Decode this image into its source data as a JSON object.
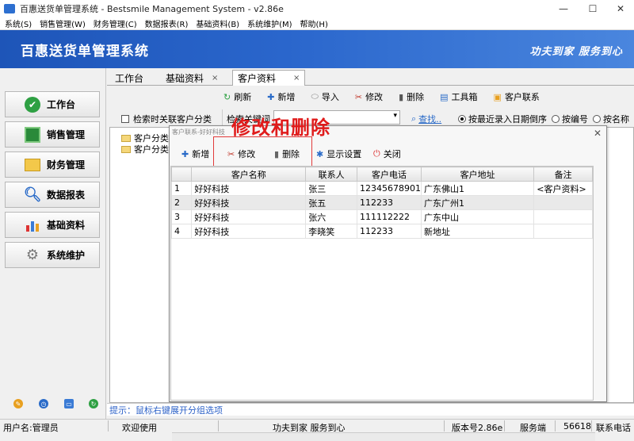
{
  "window": {
    "title": "百惠送货单管理系统 - Bestsmile Management System - v2.86e",
    "controls": {
      "minimize": "—",
      "maximize": "☐",
      "close": "✕"
    }
  },
  "menu": [
    "系统(S)",
    "销售管理(W)",
    "财务管理(C)",
    "数据报表(R)",
    "基础资料(B)",
    "系统维护(M)",
    "帮助(H)"
  ],
  "banner": {
    "title": "百惠送货单管理系统",
    "slogan": "功夫到家 服务到心"
  },
  "sidebar": {
    "items": [
      {
        "label": "工作台",
        "icon": "check-icon"
      },
      {
        "label": "销售管理",
        "icon": "sales-icon"
      },
      {
        "label": "财务管理",
        "icon": "folder-icon"
      },
      {
        "label": "数据报表",
        "icon": "magnifier-icon"
      },
      {
        "label": "基础资料",
        "icon": "chart-icon"
      },
      {
        "label": "系统维护",
        "icon": "gear-icon"
      }
    ]
  },
  "tabs": [
    {
      "label": "工作台"
    },
    {
      "label": "基础资料",
      "close": "×"
    },
    {
      "label": "客户资料",
      "close": "×"
    }
  ],
  "toolbar": {
    "refresh": "刷新",
    "add": "新增",
    "import": "导入",
    "edit": "修改",
    "delete": "删除",
    "toolbox": "工具箱",
    "contacts": "客户联系"
  },
  "search": {
    "checkbox_label": "检索时关联客户分类",
    "keyword_label": "检索关键词",
    "find_label": "查找..",
    "radios": [
      "按最近录入日期倒序",
      "按编号",
      "按名称"
    ],
    "selected_radio": 0
  },
  "tree": {
    "items": [
      "客户分类1",
      "客户分类2"
    ]
  },
  "dialog": {
    "title": "客户联系-好好科技",
    "close": "✕",
    "buttons": {
      "add": "新增",
      "edit": "修改",
      "delete": "删除",
      "display": "显示设置",
      "close": "关闭"
    },
    "overlay_annotation": "修改和删除",
    "grid": {
      "columns": [
        "",
        "客户名称",
        "联系人",
        "客户电话",
        "客户地址",
        "备注"
      ],
      "rows": [
        [
          "1",
          "好好科技",
          "张三",
          "12345678901",
          "广东佛山1",
          "<客户资料>"
        ],
        [
          "2",
          "好好科技",
          "张五",
          "112233",
          "广东广州1",
          ""
        ],
        [
          "3",
          "好好科技",
          "张六",
          "111112222",
          "广东中山",
          ""
        ],
        [
          "4",
          "好好科技",
          "李晓笑",
          "112233",
          "新地址",
          ""
        ]
      ],
      "selected_row": 1
    }
  },
  "hint": "提示：鼠标右键展开分组选项",
  "status": {
    "user": "用户名:管理员",
    "welcome": "欢迎使用",
    "slogan": "功夫到家 服务到心",
    "version": "版本号2.86e",
    "server": "服务端",
    "port": "56618",
    "contact": "联系电话"
  }
}
